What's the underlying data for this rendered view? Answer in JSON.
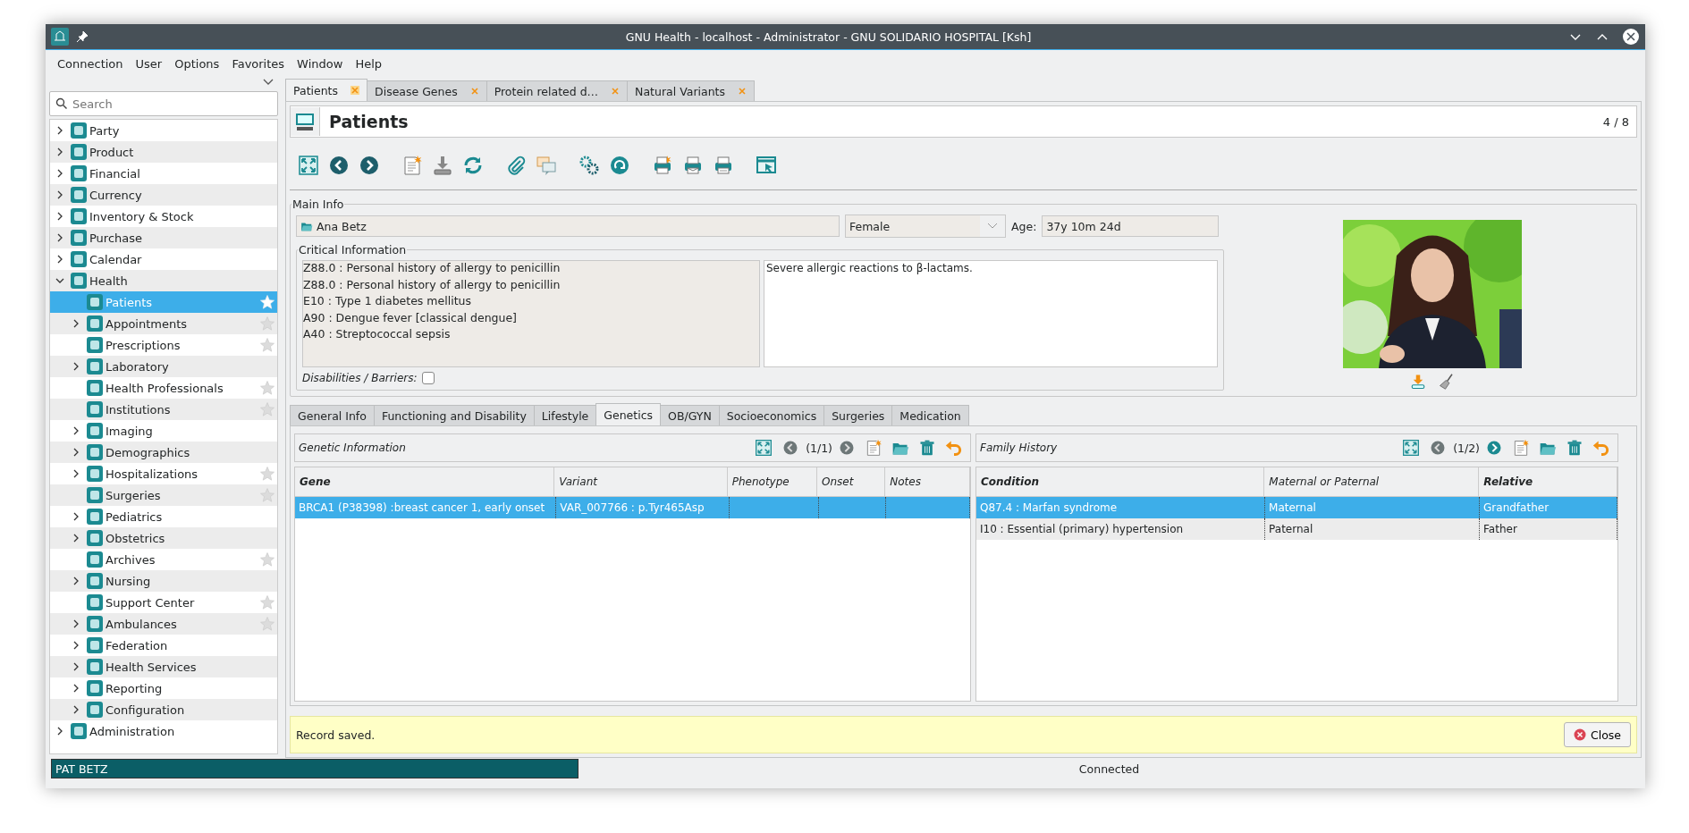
{
  "window": {
    "title": "GNU Health - localhost - Administrator - GNU SOLIDARIO HOSPITAL [Ksh]"
  },
  "menu": [
    "Connection",
    "User",
    "Options",
    "Favorites",
    "Window",
    "Help"
  ],
  "sidebar": {
    "search": {
      "placeholder": "Search"
    },
    "items": [
      {
        "label": "Party",
        "kind": "branch",
        "expanded": false,
        "starred": false,
        "selected": false
      },
      {
        "label": "Product",
        "kind": "branch",
        "expanded": false,
        "starred": false,
        "selected": false
      },
      {
        "label": "Financial",
        "kind": "branch",
        "expanded": false,
        "starred": false,
        "selected": false
      },
      {
        "label": "Currency",
        "kind": "branch",
        "expanded": false,
        "starred": false,
        "selected": false
      },
      {
        "label": "Inventory & Stock",
        "kind": "branch",
        "expanded": false,
        "starred": false,
        "selected": false
      },
      {
        "label": "Purchase",
        "kind": "branch",
        "expanded": false,
        "starred": false,
        "selected": false
      },
      {
        "label": "Calendar",
        "kind": "branch",
        "expanded": false,
        "starred": false,
        "selected": false
      },
      {
        "label": "Health",
        "kind": "branch",
        "expanded": true,
        "starred": false,
        "selected": false,
        "children": [
          {
            "label": "Patients",
            "kind": "leaf",
            "starred": true,
            "selected": true
          },
          {
            "label": "Appointments",
            "kind": "branch",
            "expanded": false,
            "starred": true,
            "selected": false
          },
          {
            "label": "Prescriptions",
            "kind": "leaf",
            "starred": true,
            "selected": false
          },
          {
            "label": "Laboratory",
            "kind": "branch",
            "expanded": false,
            "starred": false,
            "selected": false
          },
          {
            "label": "Health Professionals",
            "kind": "leaf",
            "starred": true,
            "selected": false
          },
          {
            "label": "Institutions",
            "kind": "leaf",
            "starred": true,
            "selected": false
          },
          {
            "label": "Imaging",
            "kind": "branch",
            "expanded": false,
            "starred": false,
            "selected": false
          },
          {
            "label": "Demographics",
            "kind": "branch",
            "expanded": false,
            "starred": false,
            "selected": false
          },
          {
            "label": "Hospitalizations",
            "kind": "branch",
            "expanded": false,
            "starred": true,
            "selected": false
          },
          {
            "label": "Surgeries",
            "kind": "leaf",
            "starred": true,
            "selected": false
          },
          {
            "label": "Pediatrics",
            "kind": "branch",
            "expanded": false,
            "starred": false,
            "selected": false
          },
          {
            "label": "Obstetrics",
            "kind": "branch",
            "expanded": false,
            "starred": false,
            "selected": false
          },
          {
            "label": "Archives",
            "kind": "leaf",
            "starred": true,
            "selected": false
          },
          {
            "label": "Nursing",
            "kind": "branch",
            "expanded": false,
            "starred": false,
            "selected": false
          },
          {
            "label": "Support Center",
            "kind": "leaf",
            "starred": true,
            "selected": false
          },
          {
            "label": "Ambulances",
            "kind": "branch",
            "expanded": false,
            "starred": true,
            "selected": false
          },
          {
            "label": "Federation",
            "kind": "branch",
            "expanded": false,
            "starred": false,
            "selected": false
          },
          {
            "label": "Health Services",
            "kind": "branch",
            "expanded": false,
            "starred": false,
            "selected": false
          },
          {
            "label": "Reporting",
            "kind": "branch",
            "expanded": false,
            "starred": false,
            "selected": false
          },
          {
            "label": "Configuration",
            "kind": "branch",
            "expanded": false,
            "starred": false,
            "selected": false
          }
        ]
      },
      {
        "label": "Administration",
        "kind": "branch",
        "expanded": false,
        "starred": false,
        "selected": false
      }
    ]
  },
  "tabs": [
    {
      "label": "Patients",
      "selected": true
    },
    {
      "label": "Disease Genes",
      "selected": false
    },
    {
      "label": "Protein related d…",
      "selected": false
    },
    {
      "label": "Natural Variants",
      "selected": false
    }
  ],
  "form": {
    "title": "Patients",
    "counter": "4 / 8",
    "main_info": {
      "legend": "Main Info",
      "name": "Ana Betz",
      "gender": "Female",
      "age_label": "Age:",
      "age": "37y 10m 24d",
      "critical": {
        "legend": "Critical Information",
        "conditions": [
          "Z88.0 : Personal history of allergy to penicillin",
          "Z88.0 : Personal history of allergy to penicillin",
          "E10 : Type 1 diabetes mellitus",
          "A90 : Dengue fever [classical dengue]",
          "A40 : Streptococcal sepsis"
        ],
        "notes": "Severe allergic reactions to β-lactams."
      },
      "disabilities": {
        "label": "Disabilities / Barriers:",
        "checked": false
      }
    },
    "notebook": [
      {
        "label": "General Info",
        "selected": false
      },
      {
        "label": "Functioning and Disability",
        "selected": false
      },
      {
        "label": "Lifestyle",
        "selected": false
      },
      {
        "label": "Genetics",
        "selected": true
      },
      {
        "label": "OB/GYN",
        "selected": false
      },
      {
        "label": "Socioeconomics",
        "selected": false
      },
      {
        "label": "Surgeries",
        "selected": false
      },
      {
        "label": "Medication",
        "selected": false
      }
    ],
    "panes": [
      {
        "title": "Genetic Information",
        "counter": "(1/1)",
        "next_enabled": false,
        "columns": [
          {
            "label": "Gene",
            "required": true
          },
          {
            "label": "Variant",
            "required": false
          },
          {
            "label": "Phenotype",
            "required": false
          },
          {
            "label": "Onset",
            "required": false
          },
          {
            "label": "Notes",
            "required": false
          }
        ],
        "rows": [
          {
            "cells": [
              "BRCA1 (P38398) :breast cancer 1, early onset",
              "VAR_007766 : p.Tyr465Asp"
            ],
            "selected": true
          }
        ]
      },
      {
        "title": "Family History",
        "counter": "(1/2)",
        "next_enabled": true,
        "columns": [
          {
            "label": "Condition",
            "required": true
          },
          {
            "label": "Maternal or Paternal",
            "required": false
          },
          {
            "label": "Relative",
            "required": true
          }
        ],
        "rows": [
          {
            "cells": [
              "Q87.4 : Marfan syndrome",
              "Maternal",
              "Grandfather"
            ],
            "selected": true
          },
          {
            "cells": [
              "I10 : Essential (primary) hypertension",
              "Paternal",
              "Father"
            ],
            "selected": false
          }
        ]
      }
    ]
  },
  "message": {
    "text": "Record saved.",
    "button": "Close"
  },
  "status_bar": {
    "user": "PAT BETZ",
    "connection": "Connected"
  }
}
